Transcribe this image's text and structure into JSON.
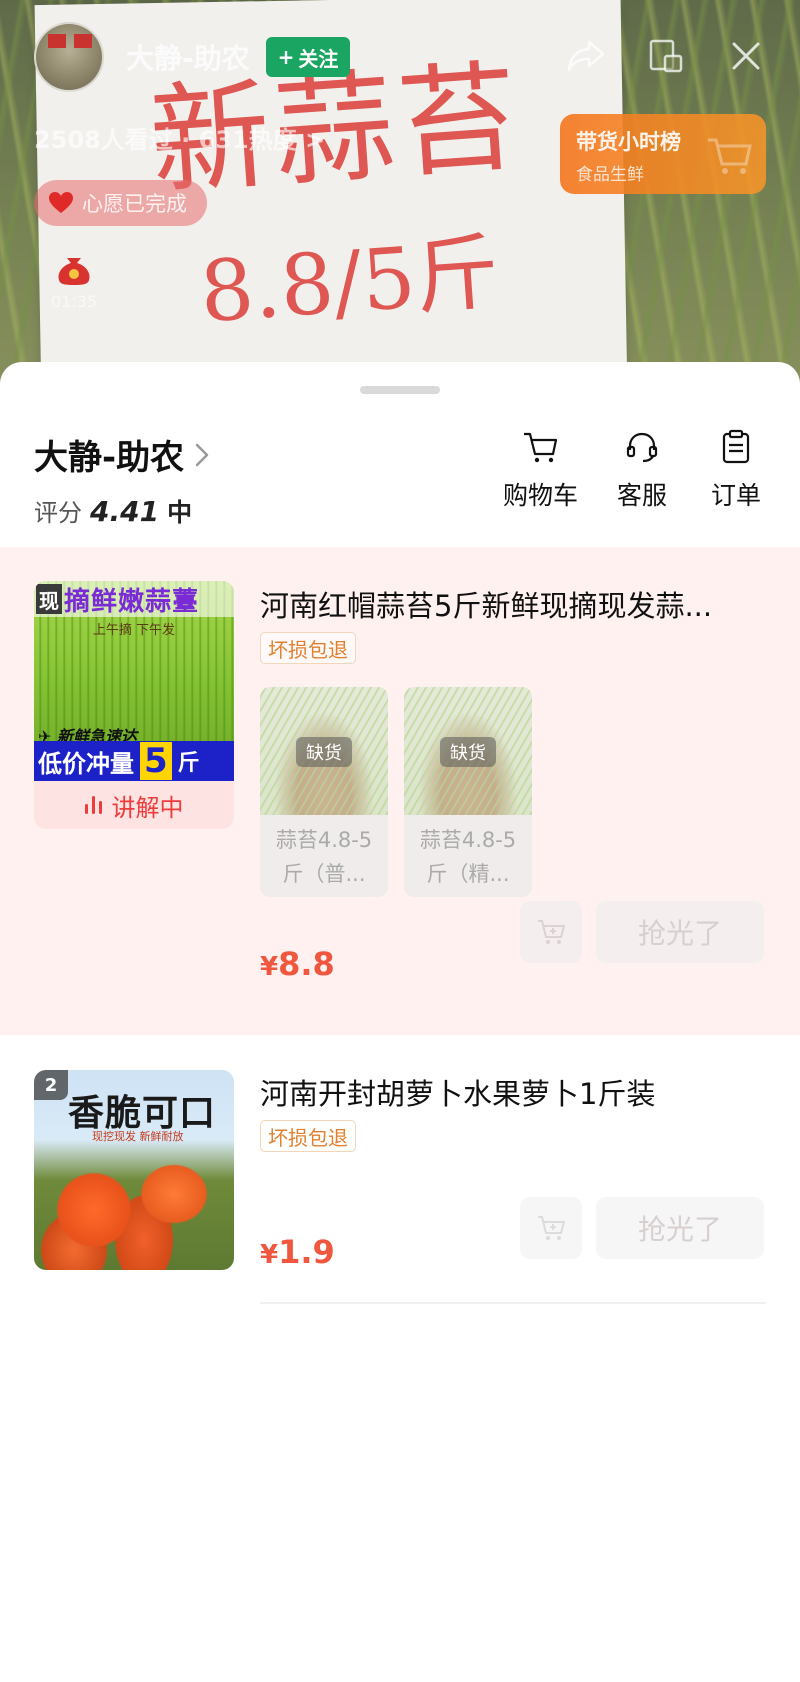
{
  "live": {
    "sign_text": "新蒜苔",
    "sign_price": "8.8/5斤",
    "streamer_name": "大静-助农",
    "follow_label": "关注",
    "viewers": "2508人看过 · 631热度 >",
    "wish_label": "心愿已完成",
    "bag_time": "01:35",
    "rank_title": "带货小时榜",
    "rank_sub": "食品生鲜",
    "icons": [
      "share-icon",
      "screen-cast-icon",
      "close-icon"
    ]
  },
  "shop": {
    "name": "大静-助农",
    "rating_label": "评分",
    "rating_value": "4.41",
    "rating_level": "中",
    "actions": [
      {
        "label": "购物车",
        "icon": "cart-icon"
      },
      {
        "label": "客服",
        "icon": "headset-icon"
      },
      {
        "label": "订单",
        "icon": "clipboard-icon"
      }
    ]
  },
  "products": [
    {
      "thumb_corner": "现",
      "thumb_title": "摘鲜嫩蒜薹",
      "thumb_sub": "上午摘 下午发",
      "thumb_express": "新鲜急速达",
      "thumb_band": "低价冲量",
      "thumb_band_num": "5",
      "thumb_band_unit": "斤",
      "live_label": "讲解中",
      "title": "河南红帽蒜苔5斤新鲜现摘现发蒜...",
      "tag": "坏损包退",
      "skus": [
        {
          "name": "蒜苔4.8-5斤（普...",
          "status": "缺货"
        },
        {
          "name": "蒜苔4.8-5斤（精...",
          "status": "缺货"
        }
      ],
      "currency": "¥",
      "price": "8.8",
      "grab_label": "抢光了"
    },
    {
      "rank": "2",
      "thumb_title": "香脆可口",
      "thumb_sub": "现挖现发 新鲜耐放",
      "title": "河南开封胡萝卜水果萝卜1斤装",
      "tag": "坏损包退",
      "currency": "¥",
      "price": "1.9",
      "grab_label": "抢光了"
    }
  ],
  "colors": {
    "accent_red": "#f0573f",
    "live_red": "#ee3b3b",
    "follow_green": "#1aa562",
    "tag_orange": "#e0802e",
    "card_highlight": "#fff1f0"
  }
}
